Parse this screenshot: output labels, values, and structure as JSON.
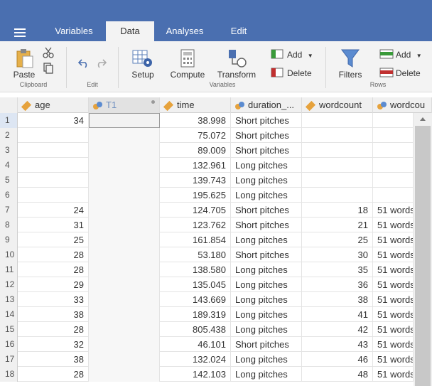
{
  "tabs": [
    {
      "label": "Variables",
      "active": false
    },
    {
      "label": "Data",
      "active": true
    },
    {
      "label": "Analyses",
      "active": false
    },
    {
      "label": "Edit",
      "active": false
    }
  ],
  "ribbon": {
    "paste": "Paste",
    "clipboard": "Clipboard",
    "edit": "Edit",
    "setup": "Setup",
    "compute": "Compute",
    "transform": "Transform",
    "variables": "Variables",
    "add_var": "Add",
    "delete_var": "Delete",
    "filters": "Filters",
    "add_row": "Add",
    "delete_row": "Delete",
    "rows": "Rows"
  },
  "columns": [
    "age",
    "T1",
    "time",
    "duration_...",
    "wordcount",
    "wordcou"
  ],
  "rows": [
    {
      "n": "1",
      "age": "34",
      "time": "38.998",
      "duration": "Short pitches",
      "wordcount": "",
      "wc2": ""
    },
    {
      "n": "2",
      "age": "",
      "time": "75.072",
      "duration": "Short pitches",
      "wordcount": "",
      "wc2": ""
    },
    {
      "n": "3",
      "age": "",
      "time": "89.009",
      "duration": "Short pitches",
      "wordcount": "",
      "wc2": ""
    },
    {
      "n": "4",
      "age": "",
      "time": "132.961",
      "duration": "Long pitches",
      "wordcount": "",
      "wc2": ""
    },
    {
      "n": "5",
      "age": "",
      "time": "139.743",
      "duration": "Long pitches",
      "wordcount": "",
      "wc2": ""
    },
    {
      "n": "6",
      "age": "",
      "time": "195.625",
      "duration": "Long pitches",
      "wordcount": "",
      "wc2": ""
    },
    {
      "n": "7",
      "age": "24",
      "time": "124.705",
      "duration": "Short pitches",
      "wordcount": "18",
      "wc2": "51 words"
    },
    {
      "n": "8",
      "age": "31",
      "time": "123.762",
      "duration": "Short pitches",
      "wordcount": "21",
      "wc2": "51 words"
    },
    {
      "n": "9",
      "age": "25",
      "time": "161.854",
      "duration": "Long pitches",
      "wordcount": "25",
      "wc2": "51 words"
    },
    {
      "n": "10",
      "age": "28",
      "time": "53.180",
      "duration": "Short pitches",
      "wordcount": "30",
      "wc2": "51 words"
    },
    {
      "n": "11",
      "age": "28",
      "time": "138.580",
      "duration": "Long pitches",
      "wordcount": "35",
      "wc2": "51 words"
    },
    {
      "n": "12",
      "age": "29",
      "time": "135.045",
      "duration": "Long pitches",
      "wordcount": "36",
      "wc2": "51 words"
    },
    {
      "n": "13",
      "age": "33",
      "time": "143.669",
      "duration": "Long pitches",
      "wordcount": "38",
      "wc2": "51 words"
    },
    {
      "n": "14",
      "age": "38",
      "time": "189.319",
      "duration": "Long pitches",
      "wordcount": "41",
      "wc2": "51 words"
    },
    {
      "n": "15",
      "age": "28",
      "time": "805.438",
      "duration": "Long pitches",
      "wordcount": "42",
      "wc2": "51 words"
    },
    {
      "n": "16",
      "age": "32",
      "time": "46.101",
      "duration": "Short pitches",
      "wordcount": "43",
      "wc2": "51 words"
    },
    {
      "n": "17",
      "age": "38",
      "time": "132.024",
      "duration": "Long pitches",
      "wordcount": "46",
      "wc2": "51 words"
    },
    {
      "n": "18",
      "age": "28",
      "time": "142.103",
      "duration": "Long pitches",
      "wordcount": "48",
      "wc2": "51 words"
    }
  ],
  "colors": {
    "topbar": "#4a6fb0",
    "accent": "#4a6fb0",
    "ruler": "#e6a23c",
    "nominal": "#5b8bd0"
  }
}
